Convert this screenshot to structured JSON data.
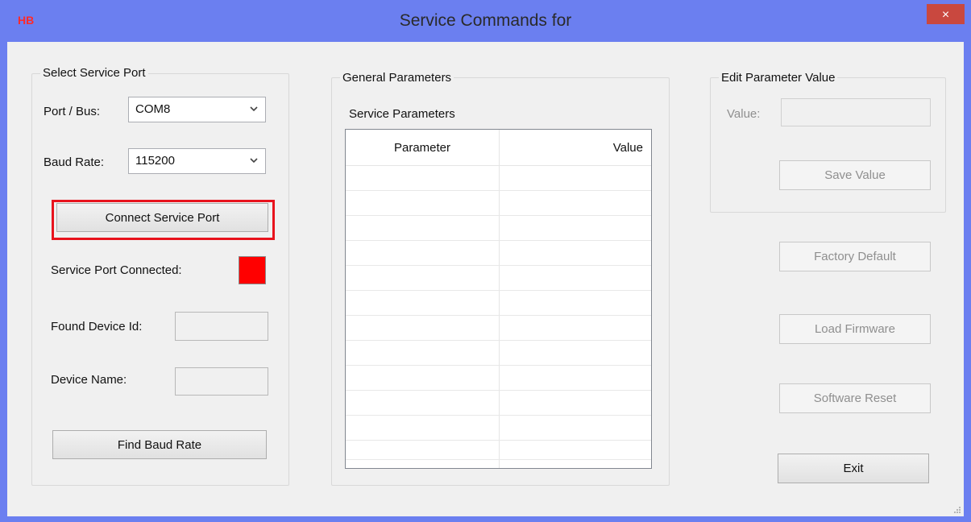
{
  "window": {
    "app_icon_text": "HB",
    "title": "Service Commands for",
    "close_glyph": "×"
  },
  "select_port": {
    "group_title": "Select Service Port",
    "port_label": "Port / Bus:",
    "port_value": "COM8",
    "baud_label": "Baud Rate:",
    "baud_value": "115200",
    "connect_button": "Connect Service Port",
    "connected_label": "Service Port Connected:",
    "connected_color": "#ff0000",
    "found_id_label": "Found Device Id:",
    "found_id_value": "",
    "device_name_label": "Device Name:",
    "device_name_value": "",
    "find_baud_button": "Find Baud Rate"
  },
  "general": {
    "group_title": "General Parameters",
    "list_label": "Service Parameters",
    "columns": [
      "Parameter",
      "Value"
    ],
    "rows": [
      [
        "",
        ""
      ],
      [
        "",
        ""
      ],
      [
        "",
        ""
      ],
      [
        "",
        ""
      ],
      [
        "",
        ""
      ],
      [
        "",
        ""
      ],
      [
        "",
        ""
      ],
      [
        "",
        ""
      ],
      [
        "",
        ""
      ],
      [
        "",
        ""
      ],
      [
        "",
        ""
      ],
      [
        "",
        ""
      ]
    ]
  },
  "edit": {
    "group_title": "Edit Parameter Value",
    "value_label": "Value:",
    "value": "",
    "save_button": "Save Value"
  },
  "actions": {
    "factory_default": "Factory Default",
    "load_firmware": "Load Firmware",
    "software_reset": "Software Reset",
    "exit": "Exit"
  },
  "colors": {
    "titlebar": "#6b7ff0",
    "highlight": "#e8131d",
    "close": "#c9483f"
  }
}
